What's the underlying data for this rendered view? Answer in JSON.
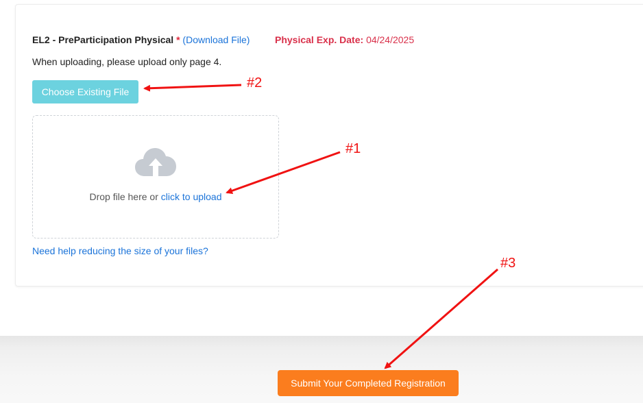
{
  "document": {
    "title": "EL2 - PreParticipation Physical",
    "required_mark": "*",
    "download_link": "(Download File)",
    "expiration_label": "Physical Exp. Date:",
    "expiration_value": "04/24/2025",
    "instruction": "When uploading, please upload only page 4."
  },
  "upload": {
    "choose_button": "Choose Existing File",
    "drop_text": "Drop file here or",
    "click_link": "click to upload",
    "cloud_icon": "cloud-upload-icon",
    "help_link": "Need help reducing the size of your files?"
  },
  "footer": {
    "submit_button": "Submit Your Completed Registration"
  },
  "annotations": {
    "label_1": "#1",
    "label_2": "#2",
    "label_3": "#3"
  },
  "colors": {
    "accent_blue": "#1a73d9",
    "button_teal": "#6cd2df",
    "submit_orange": "#fb7d1e",
    "alert_red": "#d9304a",
    "annotation_red": "#f01212"
  }
}
